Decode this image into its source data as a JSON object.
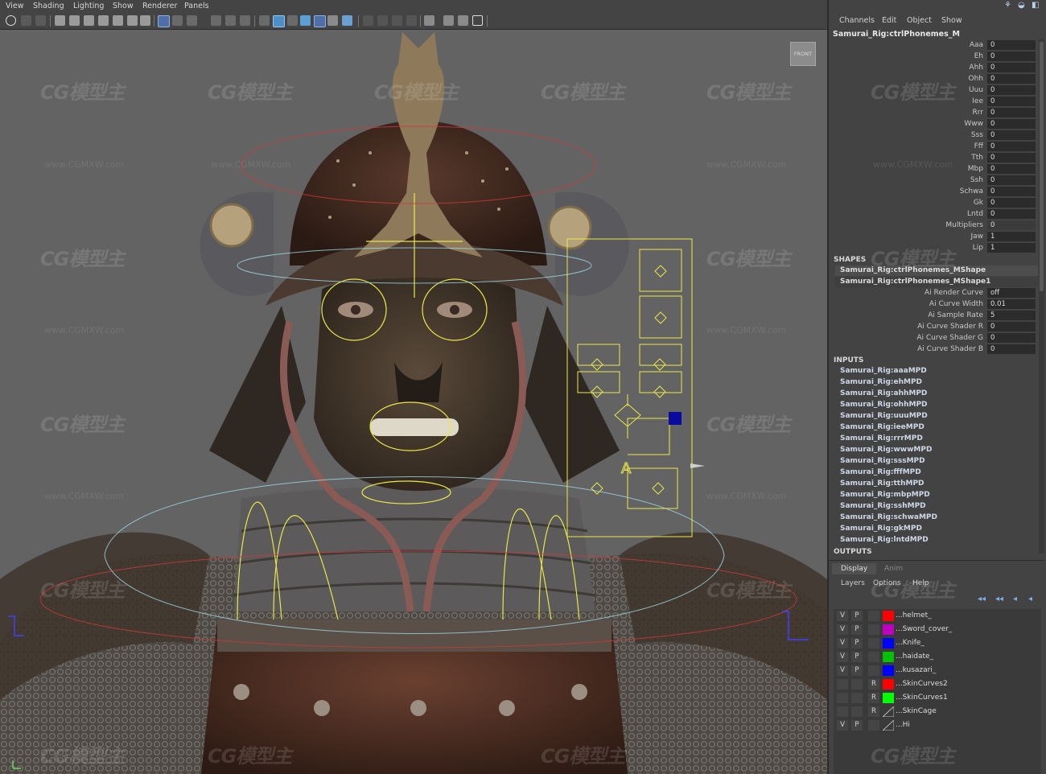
{
  "viewport": {
    "menu": [
      "View",
      "Shading",
      "Lighting",
      "Show",
      "Renderer",
      "Panels"
    ],
    "view_cube_label": "FRONT"
  },
  "channel_box": {
    "menu": [
      "Channels",
      "Edit",
      "Object",
      "Show"
    ],
    "node_name": "Samurai_Rig:ctrlPhonemes_M",
    "attributes": [
      {
        "label": "Aaa",
        "value": "0"
      },
      {
        "label": "Eh",
        "value": "0"
      },
      {
        "label": "Ahh",
        "value": "0"
      },
      {
        "label": "Ohh",
        "value": "0"
      },
      {
        "label": "Uuu",
        "value": "0"
      },
      {
        "label": "Iee",
        "value": "0"
      },
      {
        "label": "Rrr",
        "value": "0"
      },
      {
        "label": "Www",
        "value": "0"
      },
      {
        "label": "Sss",
        "value": "0"
      },
      {
        "label": "Fff",
        "value": "0"
      },
      {
        "label": "Tth",
        "value": "0"
      },
      {
        "label": "Mbp",
        "value": "0"
      },
      {
        "label": "Ssh",
        "value": "0"
      },
      {
        "label": "Schwa",
        "value": "0"
      },
      {
        "label": "Gk",
        "value": "0"
      },
      {
        "label": "Lntd",
        "value": "0"
      },
      {
        "label": "Multipliers",
        "value": "0"
      },
      {
        "label": "Jaw",
        "value": "1"
      },
      {
        "label": "Lip",
        "value": "1"
      }
    ],
    "shapes_title": "SHAPES",
    "shapes": [
      "Samurai_Rig:ctrlPhonemes_MShape",
      "Samurai_Rig:ctrlPhonemes_MShape1"
    ],
    "shape_attributes": [
      {
        "label": "Ai Render Curve",
        "value": "off"
      },
      {
        "label": "Ai Curve Width",
        "value": "0.01"
      },
      {
        "label": "Ai Sample Rate",
        "value": "5"
      },
      {
        "label": "Ai Curve Shader R",
        "value": "0"
      },
      {
        "label": "Ai Curve Shader G",
        "value": "0"
      },
      {
        "label": "Ai Curve Shader B",
        "value": "0"
      }
    ],
    "inputs_title": "INPUTS",
    "inputs": [
      "Samurai_Rig:aaaMPD",
      "Samurai_Rig:ehMPD",
      "Samurai_Rig:ahhMPD",
      "Samurai_Rig:ohhMPD",
      "Samurai_Rig:uuuMPD",
      "Samurai_Rig:ieeMPD",
      "Samurai_Rig:rrrMPD",
      "Samurai_Rig:wwwMPD",
      "Samurai_Rig:sssMPD",
      "Samurai_Rig:fffMPD",
      "Samurai_Rig:tthMPD",
      "Samurai_Rig:mbpMPD",
      "Samurai_Rig:sshMPD",
      "Samurai_Rig:schwaMPD",
      "Samurai_Rig:gkMPD",
      "Samurai_Rig:lntdMPD"
    ],
    "outputs_title": "OUTPUTS"
  },
  "layer_editor": {
    "tabs": [
      "Display",
      "Anim"
    ],
    "menu": [
      "Layers",
      "Options",
      "Help"
    ],
    "layers": [
      {
        "v": "V",
        "p": "P",
        "r": "",
        "color": "#ff0000",
        "name": "...helmet_"
      },
      {
        "v": "V",
        "p": "P",
        "r": "",
        "color": "#c000c0",
        "name": "...Sword_cover_"
      },
      {
        "v": "V",
        "p": "P",
        "r": "",
        "color": "#0000ff",
        "name": "...Knife_"
      },
      {
        "v": "V",
        "p": "P",
        "r": "",
        "color": "#00c000",
        "name": "...haidate_"
      },
      {
        "v": "V",
        "p": "P",
        "r": "",
        "color": "#0000ff",
        "name": "...kusazari_"
      },
      {
        "v": "",
        "p": "",
        "r": "R",
        "color": "#ff0000",
        "name": "...SkinCurves2"
      },
      {
        "v": "",
        "p": "",
        "r": "R",
        "color": "#00ff00",
        "name": "...SkinCurves1"
      },
      {
        "v": "",
        "p": "",
        "r": "R",
        "color": "",
        "name": "...SkinCage"
      },
      {
        "v": "V",
        "p": "P",
        "r": "",
        "color": "",
        "name": "...Hi"
      }
    ]
  },
  "watermark": {
    "logo": "CG模型主",
    "url": "www.CGMXW.com"
  }
}
